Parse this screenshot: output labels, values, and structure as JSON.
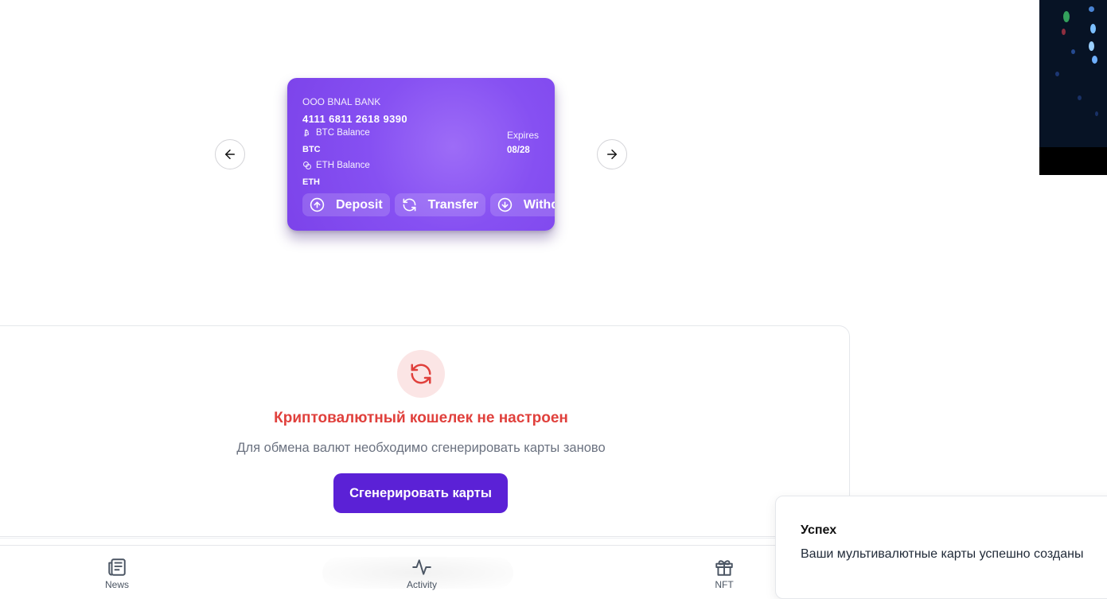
{
  "card": {
    "bank": "OOO BNAL BANK",
    "number": "4111 6811 2618 9390",
    "btc_label": "BTC Balance",
    "btc_currency": "BTC",
    "eth_label": "ETH Balance",
    "eth_currency": "ETH",
    "expires_label": "Expires",
    "expires_value": "08/28",
    "actions": [
      {
        "label": "Deposit",
        "icon": "arrow-up-circle-icon"
      },
      {
        "label": "Transfer",
        "icon": "refresh-icon"
      },
      {
        "label": "Withdraw",
        "icon": "arrow-down-circle-icon"
      }
    ]
  },
  "carousel": {
    "prev_icon": "arrow-left-icon",
    "next_icon": "arrow-right-icon"
  },
  "wallet": {
    "title": "Криптовалютный кошелек не настроен",
    "subtitle": "Для обмена валют необходимо сгенерировать карты заново",
    "button": "Сгенерировать карты",
    "icon": "refresh-icon",
    "accent": "#e0403c",
    "button_color": "#5b21d6"
  },
  "bottom_nav": [
    {
      "label": "News",
      "icon": "newspaper-icon"
    },
    {
      "label": "Activity",
      "icon": "activity-icon"
    },
    {
      "label": "NFT",
      "icon": "gift-icon"
    }
  ],
  "toast": {
    "title": "Успех",
    "message": "Ваши мультивалютные карты успешно созданы"
  },
  "colors": {
    "card_purple": "#8650f2"
  }
}
